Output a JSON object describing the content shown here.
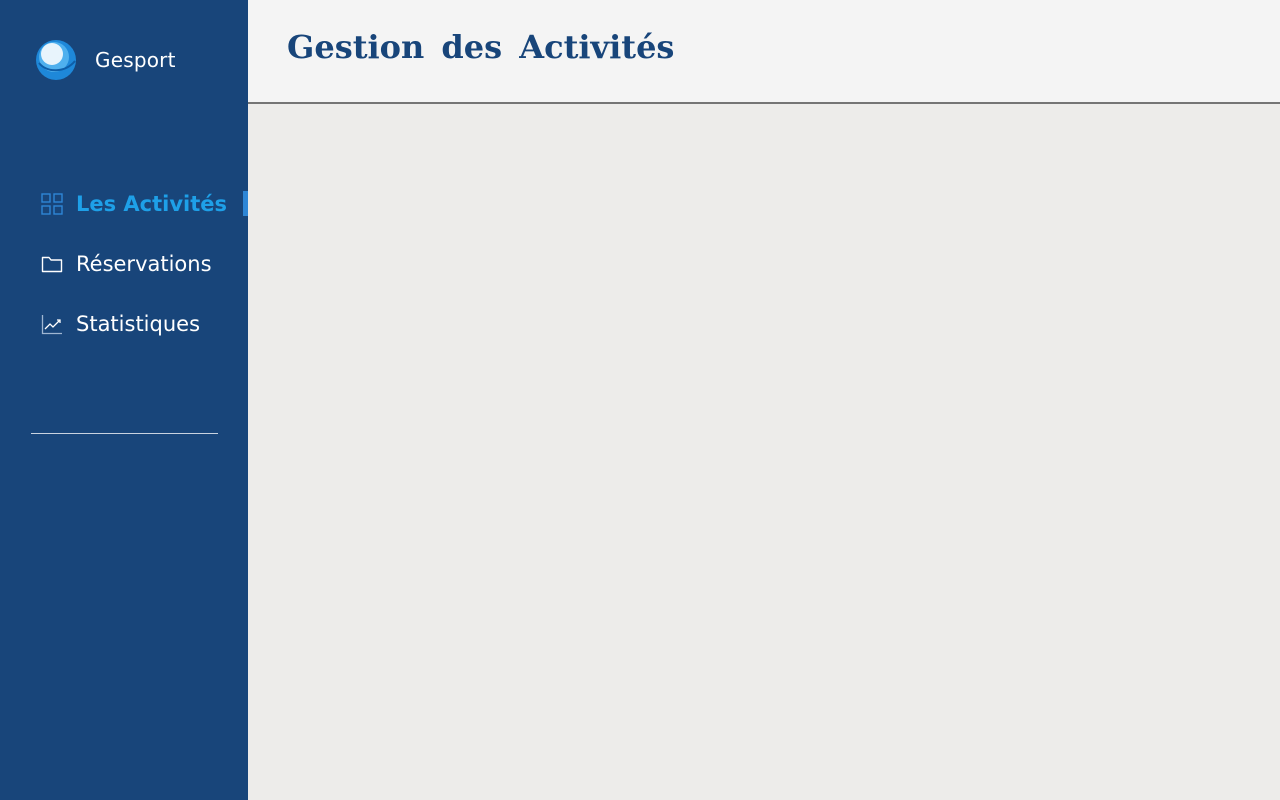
{
  "app": {
    "name": "Gesport"
  },
  "header": {
    "title": "Gestion des Activités"
  },
  "sidebar": {
    "items": [
      {
        "label": "Les Activités",
        "icon": "grid-icon",
        "active": true
      },
      {
        "label": "Réservations",
        "icon": "folder-icon",
        "active": false
      },
      {
        "label": "Statistiques",
        "icon": "chart-line-icon",
        "active": false
      }
    ]
  },
  "colors": {
    "sidebar_bg": "#18457a",
    "accent": "#1ea0e8",
    "active_indicator": "#2e86d6",
    "header_bg": "#f4f4f4",
    "content_bg": "#edecea"
  }
}
